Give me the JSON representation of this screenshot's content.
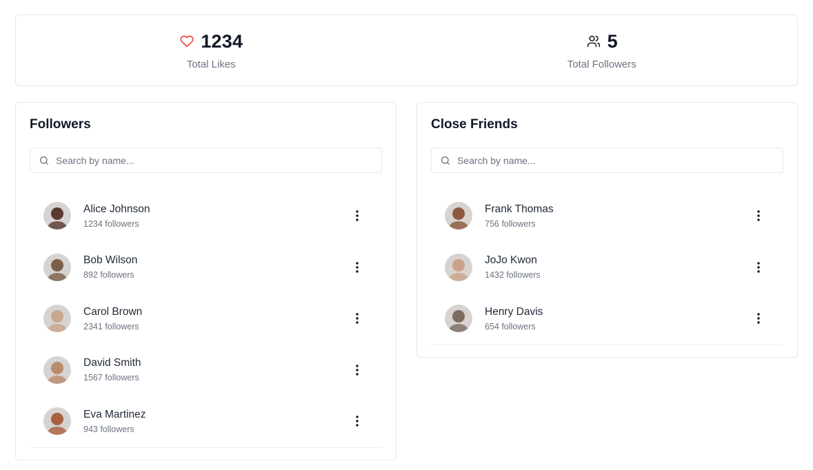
{
  "stats": {
    "likes": {
      "value": "1234",
      "label": "Total Likes",
      "icon": "heart-icon",
      "icon_color": "#ef4444"
    },
    "followers": {
      "value": "5",
      "label": "Total Followers",
      "icon": "users-icon",
      "icon_color": "#111827"
    }
  },
  "followers_panel": {
    "title": "Followers",
    "search_placeholder": "Search by name...",
    "items": [
      {
        "name": "Alice Johnson",
        "followers": "1234 followers",
        "avatar_color": "#5a3a2e"
      },
      {
        "name": "Bob Wilson",
        "followers": "892 followers",
        "avatar_color": "#7a6048"
      },
      {
        "name": "Carol Brown",
        "followers": "2341 followers",
        "avatar_color": "#c9a68c"
      },
      {
        "name": "David Smith",
        "followers": "1567 followers",
        "avatar_color": "#b98c6a"
      },
      {
        "name": "Eva Martinez",
        "followers": "943 followers",
        "avatar_color": "#a9603e"
      }
    ]
  },
  "friends_panel": {
    "title": "Close Friends",
    "search_placeholder": "Search by name...",
    "items": [
      {
        "name": "Frank Thomas",
        "followers": "756 followers",
        "avatar_color": "#8b5a3c"
      },
      {
        "name": "JoJo Kwon",
        "followers": "1432 followers",
        "avatar_color": "#caa28a"
      },
      {
        "name": "Henry Davis",
        "followers": "654 followers",
        "avatar_color": "#7d6a60"
      }
    ]
  }
}
